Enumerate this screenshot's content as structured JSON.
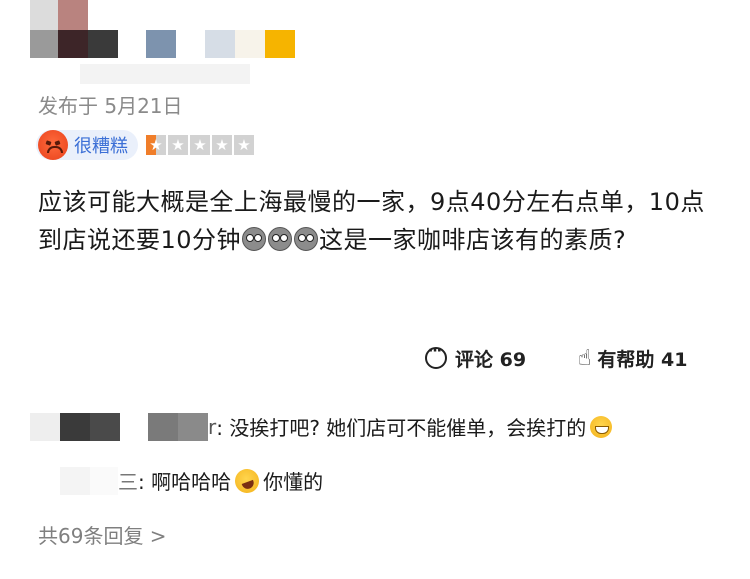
{
  "review": {
    "publish_date": "发布于 5月21日",
    "rating": {
      "label": "很糟糕",
      "stars_filled": 0.5,
      "stars_total": 5,
      "accent_color": "#f07e2a"
    },
    "text_before_emoji": "应该可能大概是全上海最慢的一家，9点40分左右点单，10点到店说还要10分钟",
    "text_after_emoji": "这是一家咖啡店该有的素质?",
    "emoji_count": 3
  },
  "actions": {
    "comment_label": "评论 69",
    "helpful_label": "有帮助 41"
  },
  "replies": [
    {
      "author_suffix": "r",
      "text": ": 没挨打吧? 她们店可不能催单，会挨打的"
    },
    {
      "author_suffix": "三",
      "text": ": 啊哈哈哈",
      "text_after": "你懂的"
    }
  ],
  "more_replies": "共69条回复 >",
  "icons": {
    "rating_face": "angry-face-icon",
    "comment": "comment-bubble-icon",
    "helpful": "thumbs-up-hand-icon"
  }
}
